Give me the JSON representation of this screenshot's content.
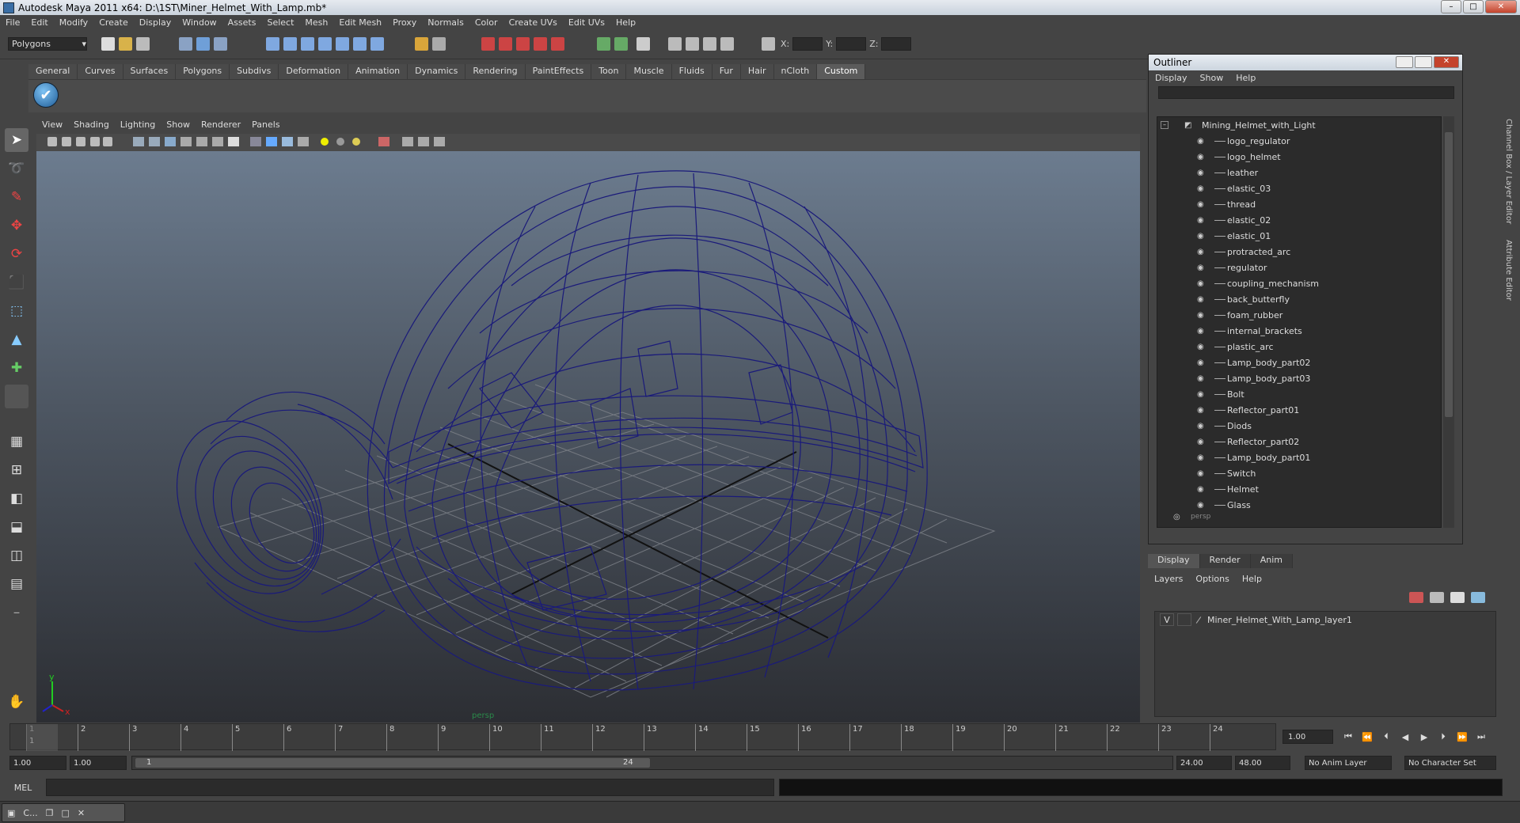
{
  "window": {
    "title": "Autodesk Maya 2011 x64: D:\\1ST\\Miner_Helmet_With_Lamp.mb*",
    "minimize": "–",
    "maximize": "□",
    "close": "✕"
  },
  "menubar": [
    "File",
    "Edit",
    "Modify",
    "Create",
    "Display",
    "Window",
    "Assets",
    "Select",
    "Mesh",
    "Edit Mesh",
    "Proxy",
    "Normals",
    "Color",
    "Create UVs",
    "Edit UVs",
    "Help"
  ],
  "status_line": {
    "mode": "Polygons",
    "x_label": "X:",
    "y_label": "Y:",
    "z_label": "Z:"
  },
  "shelf": {
    "tabs": [
      "General",
      "Curves",
      "Surfaces",
      "Polygons",
      "Subdivs",
      "Deformation",
      "Animation",
      "Dynamics",
      "Rendering",
      "PaintEffects",
      "Toon",
      "Muscle",
      "Fluids",
      "Fur",
      "Hair",
      "nCloth",
      "Custom"
    ],
    "active_tab": "Custom"
  },
  "panel": {
    "menu": [
      "View",
      "Shading",
      "Lighting",
      "Show",
      "Renderer",
      "Panels"
    ],
    "camera_label": "persp",
    "axis_y": "y",
    "axis_x": "x"
  },
  "outliner": {
    "title": "Outliner",
    "menu": [
      "Display",
      "Show",
      "Help"
    ],
    "root": "Mining_Helmet_with_Light",
    "items": [
      "logo_regulator",
      "logo_helmet",
      "leather",
      "elastic_03",
      "thread",
      "elastic_02",
      "elastic_01",
      "protracted_arc",
      "regulator",
      "coupling_mechanism",
      "back_butterfly",
      "foam_rubber",
      "internal_brackets",
      "plastic_arc",
      "Lamp_body_part02",
      "Lamp_body_part03",
      "Bolt",
      "Reflector_part01",
      "Diods",
      "Reflector_part02",
      "Lamp_body_part01",
      "Switch",
      "Helmet",
      "Glass"
    ],
    "partial_item": "persp"
  },
  "layer_editor": {
    "tabs": [
      "Display",
      "Render",
      "Anim"
    ],
    "active_tab": "Display",
    "menu": [
      "Layers",
      "Options",
      "Help"
    ],
    "layer_visible": "V",
    "layer_name": "Miner_Helmet_With_Lamp_layer1"
  },
  "side_tabs": [
    "Channel Box / Layer Editor",
    "Attribute Editor"
  ],
  "timeline": {
    "ticks": [
      "1",
      "2",
      "3",
      "4",
      "5",
      "6",
      "7",
      "8",
      "9",
      "10",
      "11",
      "12",
      "13",
      "14",
      "15",
      "16",
      "17",
      "18",
      "19",
      "20",
      "21",
      "22",
      "23",
      "24"
    ],
    "current_frame": "1.00",
    "playhead_label": "1"
  },
  "range": {
    "start_time": "1.00",
    "playback_start": "1.00",
    "slider_start": "1",
    "slider_end": "24",
    "playback_end": "24.00",
    "end_time": "48.00",
    "anim_layer": "No Anim Layer",
    "character_set": "No Character Set"
  },
  "command_line": {
    "label": "MEL"
  },
  "taskbar": {
    "item_label": "C..."
  },
  "colors": {
    "wireframe": "#1a1a7a",
    "grid": "#8a8d93",
    "ui_bg": "#444444"
  }
}
